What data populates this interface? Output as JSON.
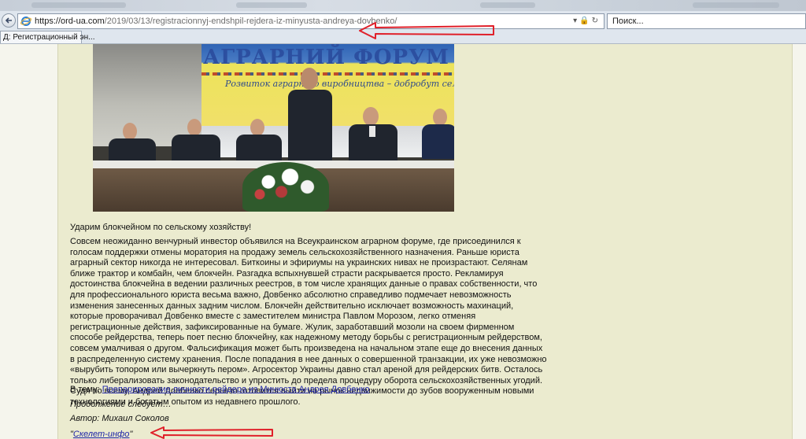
{
  "browser": {
    "url_host": "https://ord-ua.com",
    "url_path": "/2019/03/13/registracionnyj-endshpil-rejdera-iz-minyusta-andreya-dovbenko/",
    "search_placeholder": "Поиск...",
    "tab_title": "Д: Регистрационный эн..."
  },
  "photo": {
    "banner_title": "АГРАРНИЙ ФОРУМ",
    "banner_subtitle": "Розвиток аграрного виробництва – добробут села"
  },
  "article": {
    "lead": "Ударим блокчейном по сельскому хозяйству!",
    "body": "Совсем неожиданно венчурный инвестор объявился на Всеукраинском аграрном форуме, где присоединился к голосам поддержки отмены моратория на продажу земель сельскохозяйственного назначения. Раньше юриста аграрный сектор никогда не интересовал. Биткоины и эфириумы на украинских нивах не произрастают. Селянам ближе трактор и комбайн, чем блокчейн. Разгадка вспыхнувшей страсти раскрывается просто. Рекламируя достоинства блокчейна в ведении различных реестров, в том числе хранящих данные о правах собственности, что для профессионального юриста весьма важно, Довбенко абсолютно справедливо подмечает невозможность изменения занесенных данных задним числом. Блокчейн действительно исключает возможность махинаций, которые проворачивал Довбенко вместе с заместителем министра Павлом Морозом, легко отменяя регистрационные действия, зафиксированные на бумаге. Жулик, заработавший мозоли на своем фирменном способе рейдерства, теперь поет песню блокчейну, как надежному методу борьбы с регистрационным рейдерством, совсем умалчивая о другом. Фальсификация может быть произведена на начальном этапе еще до внесения данных в распределенную систему хранения. После попадания в нее данных о совершенной транзакции, их уже невозможно «вырубить топором или вычеркнуть пером». Агросектор Украины давно стал ареной для рейдерских битв. Осталось только либерализовать законодательство и упростить до предела процедуру оборота сельскохозяйственных угодий. Судя по всему, Андрей Довбенко серьезо готовится выйти на рынок недвижимости до зубов вооруженным новыми технологиями и богатым опытом из недавнего прошлого.",
    "related_prefix": "В тему: ",
    "related_link": "Препарирование личности рейдера из Минюста Андрея Довбенко",
    "continued": "Продолжение следует…",
    "author": "Автор: Михаил Соколов",
    "source_open_quote": "\"",
    "source_link": "Скелет-инфо",
    "source_close_quote": "\""
  },
  "colors": {
    "annotation_arrow": "#e0202a",
    "link": "#1d23a8",
    "content_background": "#ebebcf"
  }
}
